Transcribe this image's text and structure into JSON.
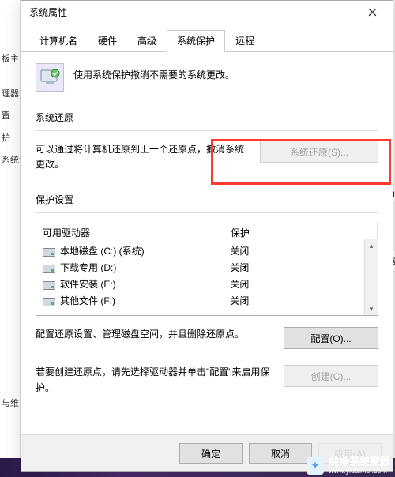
{
  "backdrop_items": [
    "板主",
    "理器",
    "置",
    "护",
    "系统设",
    "与维"
  ],
  "partial_right_1": "U",
  "partial_right_2": "器",
  "dialog": {
    "title": "系统属性",
    "tabs": [
      {
        "label": "计算机名"
      },
      {
        "label": "硬件"
      },
      {
        "label": "高级"
      },
      {
        "label": "系统保护"
      },
      {
        "label": "远程"
      }
    ],
    "active_tab": 3,
    "intro_text": "使用系统保护撤消不需要的系统更改。",
    "restore": {
      "heading": "系统还原",
      "desc": "可以通过将计算机还原到上一个还原点，撤消系统更改。",
      "button": "系统还原(S)..."
    },
    "protection": {
      "heading": "保护设置",
      "col_drive": "可用驱动器",
      "col_status": "保护",
      "drives": [
        {
          "name": "本地磁盘 (C:) (系统)",
          "status": "关闭"
        },
        {
          "name": "下载专用 (D:)",
          "status": "关闭"
        },
        {
          "name": "软件安装 (E:)",
          "status": "关闭"
        },
        {
          "name": "其他文件 (F:)",
          "status": "关闭"
        }
      ],
      "config_desc": "配置还原设置、管理磁盘空间，并且删除还原点。",
      "config_button": "配置(O)...",
      "create_desc": "若要创建还原点，请先选择驱动器并单击\"配置\"来启用保护。",
      "create_button": "创建(C)..."
    },
    "footer": {
      "ok": "确定",
      "cancel": "取消",
      "apply": "应用(A)"
    }
  },
  "watermark": {
    "brand": "纯净系统家园",
    "url": "www.yidaimei.com"
  }
}
